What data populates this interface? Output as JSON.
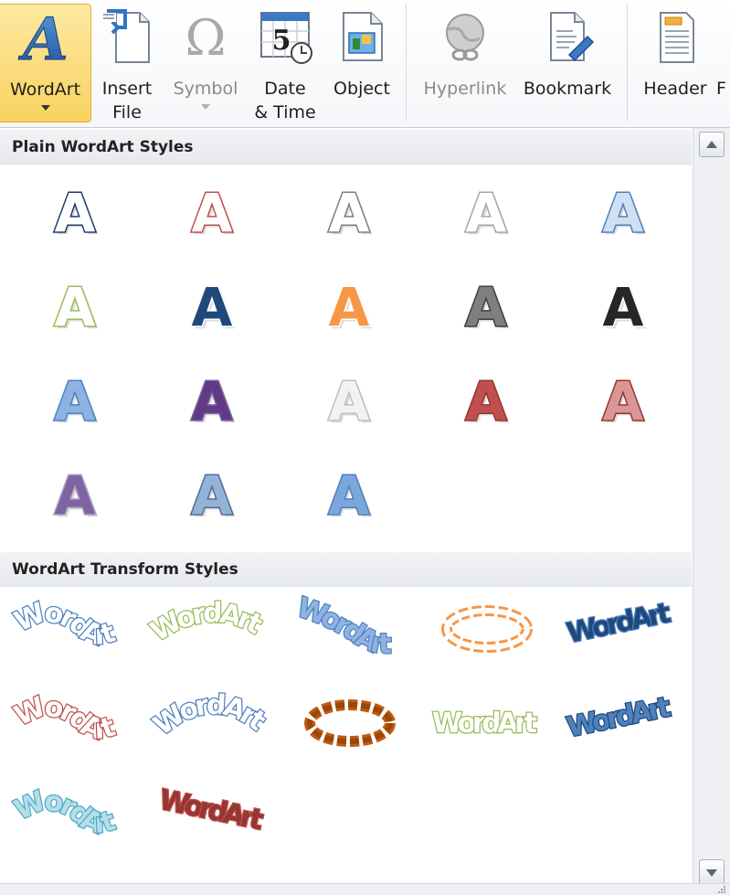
{
  "ribbon": {
    "buttons": [
      {
        "label": "WordArt",
        "icon": "wordart-icon",
        "active": true,
        "dropdown": true
      },
      {
        "label": "Insert\nFile",
        "icon": "insert-file-icon"
      },
      {
        "label": "Symbol",
        "icon": "omega-symbol-icon",
        "disabled": true,
        "dropdown": true
      },
      {
        "label": "Date\n& Time",
        "icon": "calendar-clock-icon"
      },
      {
        "label": "Object",
        "icon": "object-icon"
      },
      {
        "label": "Hyperlink",
        "icon": "globe-link-icon",
        "disabled": true
      },
      {
        "label": "Bookmark",
        "icon": "bookmark-icon"
      },
      {
        "label": "Header",
        "icon": "header-icon"
      },
      {
        "label": "F",
        "icon": "footer-icon"
      }
    ]
  },
  "gallery": {
    "plain_section_title": "Plain WordArt Styles",
    "transform_section_title": "WordArt Transform Styles",
    "plain_sample_letter": "A",
    "transform_sample_text": "WordArt",
    "plain_styles": [
      {
        "fill": "#ffffff",
        "stroke": "#1f3d6b"
      },
      {
        "fill": "#ffffff",
        "stroke": "#c0504d"
      },
      {
        "fill": "#ffffff",
        "stroke": "#7f7f7f"
      },
      {
        "fill": "#ffffff",
        "stroke": "#a6a6a6"
      },
      {
        "fill": "#cfe0f3",
        "stroke": "#4f81bd"
      },
      {
        "fill": "#ffffff",
        "stroke": "#9bbb59"
      },
      {
        "fill": "#1f497d",
        "stroke": "#ffffff"
      },
      {
        "fill": "#f79646",
        "stroke": "#ffffff"
      },
      {
        "fill": "#7f7f7f",
        "stroke": "#404040"
      },
      {
        "fill": "#262626",
        "stroke": "#ffffff"
      },
      {
        "fill": "#8db3e2",
        "stroke": "#4f81bd"
      },
      {
        "fill": "#5f3b86",
        "stroke": "#8064a2"
      },
      {
        "fill": "#f2f2f2",
        "stroke": "#bfbfbf"
      },
      {
        "fill": "#c0504d",
        "stroke": "#943634"
      },
      {
        "fill": "#d99694",
        "stroke": "#953735"
      },
      {
        "fill": "#8064a2",
        "stroke": "#b3a2c7"
      },
      {
        "fill": "#95b3d7",
        "stroke": "#4f6f96"
      },
      {
        "fill": "#7ba7dc",
        "stroke": "#4f81bd"
      }
    ],
    "transform_styles": [
      {
        "shape": "wave",
        "fill": "#ffffff",
        "stroke": "#4f81bd"
      },
      {
        "shape": "arch-up",
        "fill": "#ffffff",
        "stroke": "#9bbb59"
      },
      {
        "shape": "wave-down",
        "fill": "#8db3e2",
        "stroke": "#4f81bd"
      },
      {
        "shape": "circle",
        "fill": "#ffffff",
        "stroke": "#f79646"
      },
      {
        "shape": "slant",
        "fill": "#1f497d",
        "stroke": "#4f81bd"
      },
      {
        "shape": "wave",
        "fill": "#ffffff",
        "stroke": "#c0504d"
      },
      {
        "shape": "arc",
        "fill": "#ffffff",
        "stroke": "#4f81bd"
      },
      {
        "shape": "circle",
        "fill": "#984807",
        "stroke": "#c55a11"
      },
      {
        "shape": "plain",
        "fill": "#ffffff",
        "stroke": "#9bbb59"
      },
      {
        "shape": "slant",
        "fill": "#4f81bd",
        "stroke": "#1f497d"
      },
      {
        "shape": "wave",
        "fill": "#b7dde8",
        "stroke": "#4bacc6"
      },
      {
        "shape": "slant-down",
        "fill": "#943634",
        "stroke": "#c0504d"
      }
    ]
  },
  "colors": {
    "ribbon_active": "#f9d260",
    "section_header": "#e6e9ee",
    "scrollbar": "#eef0f3"
  }
}
